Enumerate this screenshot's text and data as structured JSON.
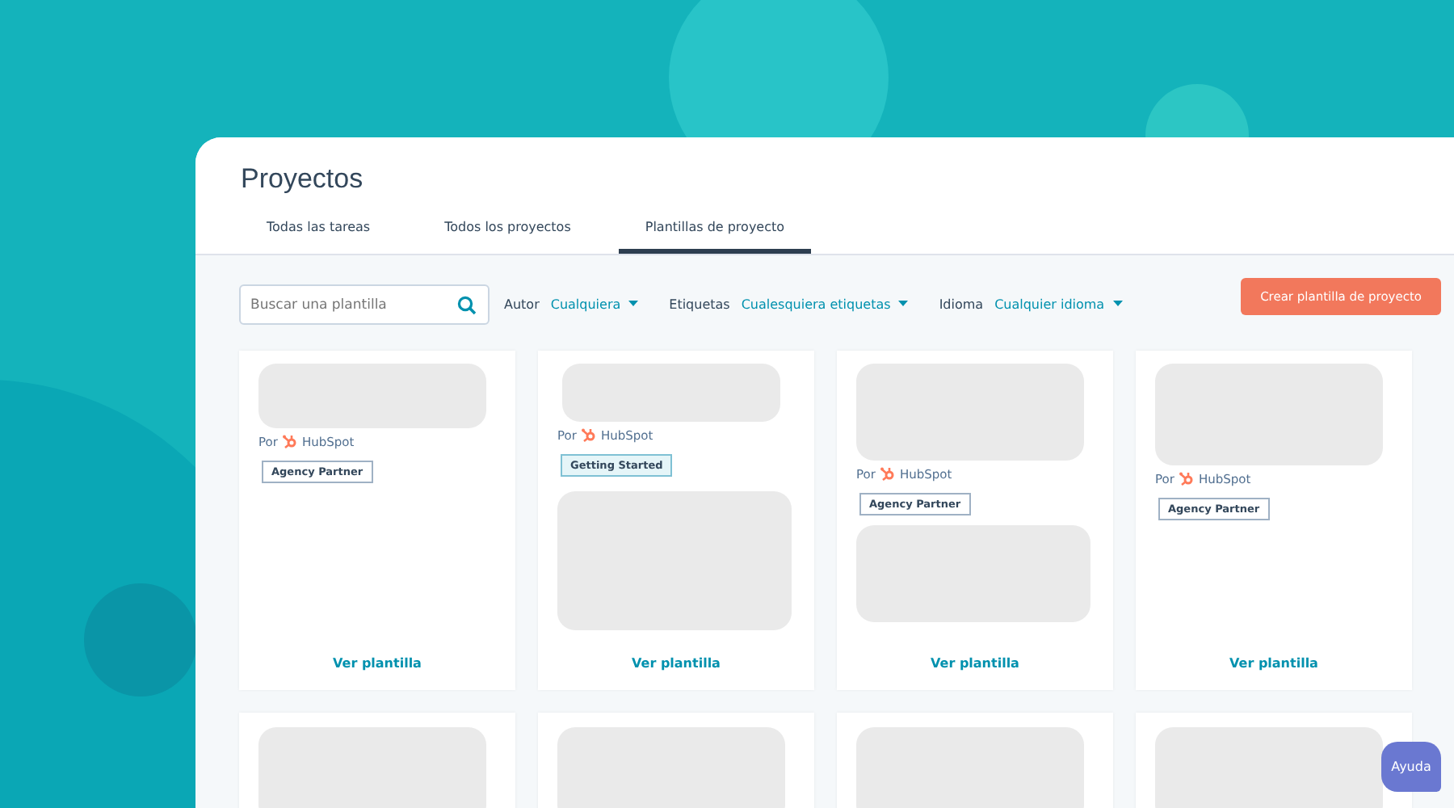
{
  "page": {
    "title": "Proyectos"
  },
  "tabs": [
    {
      "label": "Todas las tareas",
      "selected": false
    },
    {
      "label": "Todos los proyectos",
      "selected": false
    },
    {
      "label": "Plantillas de proyecto",
      "selected": true
    }
  ],
  "search": {
    "placeholder": "Buscar una plantilla"
  },
  "filters": [
    {
      "label": "Autor",
      "value": "Cualquiera"
    },
    {
      "label": "Etiquetas",
      "value": "Cualesquiera etiquetas"
    },
    {
      "label": "Idioma",
      "value": "Cualquier idioma"
    }
  ],
  "create_button": "Crear plantilla de proyecto",
  "cards": [
    {
      "by": "Por",
      "author": "HubSpot",
      "tag": "Agency Partner",
      "tag_highlighted": false,
      "preview": false,
      "link": "Ver plantilla"
    },
    {
      "by": "Por",
      "author": "HubSpot",
      "tag": "Getting Started",
      "tag_highlighted": true,
      "preview": true,
      "link": "Ver plantilla"
    },
    {
      "by": "Por",
      "author": "HubSpot",
      "tag": "Agency Partner",
      "tag_highlighted": false,
      "preview": true,
      "link": "Ver plantilla"
    },
    {
      "by": "Por",
      "author": "HubSpot",
      "tag": "Agency Partner",
      "tag_highlighted": false,
      "preview": false,
      "link": "Ver plantilla"
    }
  ],
  "help_button": "Ayuda"
}
